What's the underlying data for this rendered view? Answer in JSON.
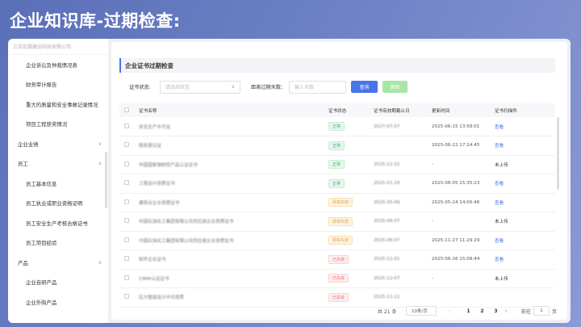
{
  "page_title": "企业知识库-过期检查:",
  "sidebar": {
    "company": "江苏宏晟建设科技有限公司",
    "items": [
      {
        "label": "企业诉讼及仲裁情况表",
        "type": "item"
      },
      {
        "label": "财务审计报告",
        "type": "item"
      },
      {
        "label": "重大的质量和安全事故记录情况",
        "type": "item"
      },
      {
        "label": "项目工程获奖情况",
        "type": "item"
      },
      {
        "label": "企业业绩",
        "type": "group",
        "chevron": "∨"
      },
      {
        "label": "员工",
        "type": "group",
        "chevron": "∧"
      },
      {
        "label": "员工基本信息",
        "type": "item"
      },
      {
        "label": "员工执业或职业资格证明",
        "type": "item"
      },
      {
        "label": "员工安全生产考核合格证书",
        "type": "item"
      },
      {
        "label": "员工项目经验",
        "type": "item"
      },
      {
        "label": "产品",
        "type": "group",
        "chevron": "∧"
      },
      {
        "label": "企业自研产品",
        "type": "item"
      },
      {
        "label": "企业外购产品",
        "type": "item"
      }
    ]
  },
  "main": {
    "section_title": "企业证书过期检查",
    "filters": {
      "status_label": "证书状态:",
      "status_placeholder": "请选择状态",
      "days_label": "距离过期天数:",
      "days_placeholder": "输入天数",
      "query_button": "查询",
      "update_button": "更新"
    },
    "table": {
      "columns": [
        "证书名称",
        "证书状态",
        "证书有效期截止日",
        "更新时间",
        "证书扫描件"
      ],
      "rows": [
        {
          "name": "安全生产许可证",
          "status": "正常",
          "status_type": "green",
          "expiry": "2027-07-07",
          "updated": "2025-06-15 13:58:01",
          "scan": "查看",
          "scan_link": true
        },
        {
          "name": "税务登记证",
          "status": "正常",
          "status_type": "green",
          "expiry": "",
          "updated": "2025-06-22 17:24:45",
          "scan": "查看",
          "scan_link": true
        },
        {
          "name": "中国国家强制性产品认证证书",
          "status": "正常",
          "status_type": "green",
          "expiry": "2025-12-31",
          "updated": "-",
          "scan": "未上传",
          "scan_link": false
        },
        {
          "name": "工程设计资质证书",
          "status": "正常",
          "status_type": "green",
          "expiry": "2025-01-16",
          "updated": "2025-06-05 15:35:23",
          "scan": "查看",
          "scan_link": true
        },
        {
          "name": "建筑业企业资质证书",
          "status": "即将失效",
          "status_type": "orange",
          "expiry": "2025-05-06",
          "updated": "2025-05-24 14:00:46",
          "scan": "查看",
          "scan_link": true
        },
        {
          "name": "中国石油化工集团有限公司供应商企业资质证书",
          "status": "即将失效",
          "status_type": "orange",
          "expiry": "2025-06-07",
          "updated": "-",
          "scan": "未上传",
          "scan_link": false
        },
        {
          "name": "中国石油化工集团有限公司供应商企业资质证书",
          "status": "即将失效",
          "status_type": "orange",
          "expiry": "2025-06-07",
          "updated": "2025-11-27 11:29:29",
          "scan": "查看",
          "scan_link": true
        },
        {
          "name": "软件企业证书",
          "status": "已失效",
          "status_type": "red",
          "expiry": "2025-12-01",
          "updated": "2025-06-26 15:08:44",
          "scan": "查看",
          "scan_link": true
        },
        {
          "name": "CMMI认证证书",
          "status": "已失效",
          "status_type": "red",
          "expiry": "2025-12-07",
          "updated": "-",
          "scan": "未上传",
          "scan_link": false
        },
        {
          "name": "压力管道设计许可资质",
          "status": "已失效",
          "status_type": "red",
          "expiry": "2025-12-11",
          "updated": "",
          "scan": "",
          "scan_link": false
        }
      ]
    },
    "pagination": {
      "total": "共 21 条",
      "page_size": "10条/页",
      "pages": [
        "1",
        "2",
        "3"
      ],
      "current_page": "1",
      "goto_label": "前往",
      "goto_value": "1",
      "goto_suffix": "页"
    }
  },
  "colors": {
    "accent": "#4a74e8",
    "update_button": "#a8e6a8",
    "bg": "#6b7fc4"
  }
}
